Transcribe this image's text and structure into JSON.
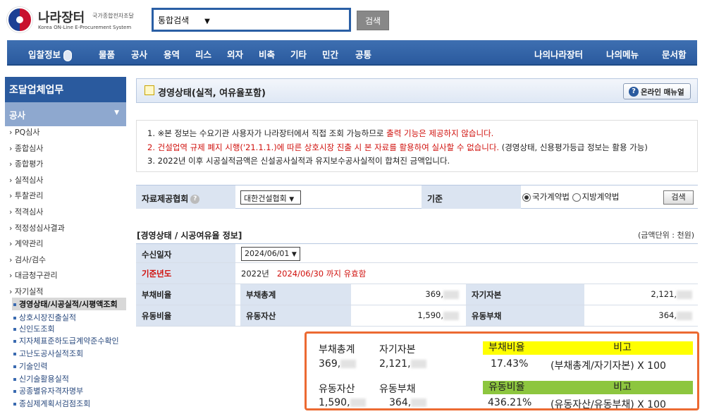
{
  "header": {
    "logo_title": "나라장터",
    "logo_subtitle": "국가종합전자조달",
    "logo_english": "Korea ON-Line E-Procurement System",
    "search_select": "통합검색",
    "search_button": "검색"
  },
  "gnb": {
    "items": [
      "입찰정보",
      "물품",
      "공사",
      "용역",
      "리스",
      "외자",
      "비축",
      "기타",
      "민간",
      "공통"
    ],
    "right_items": [
      "나의나라장터",
      "나의메뉴",
      "문서함"
    ]
  },
  "sidebar": {
    "title": "조달업체업무",
    "section": "공사",
    "items": [
      "PQ심사",
      "종합심사",
      "종합평가",
      "실적심사",
      "투찰관리",
      "적격심사",
      "적정성심사결과",
      "계약관리",
      "검사/검수",
      "대금청구관리",
      "자기실적"
    ],
    "sub_items": [
      "경영상태/시공실적/시평액조회",
      "상호시장진출실적",
      "신인도조회",
      "지자체표준하도급계약준수확인",
      "고난도공사실적조회",
      "기술인력",
      "신기술활용실적",
      "공종별유자격자명부",
      "종심제계획서검점조회"
    ]
  },
  "page": {
    "title": "경영상태(실적, 여유율포함)",
    "manual_button": "온라인 매뉴얼"
  },
  "notice": {
    "line1_a": "1. ※본 정보는 수요기관 사용자가 나라장터에서 직접 조회 가능하므로 ",
    "line1_red": "출력 기능은 제공하지 않습니다.",
    "line2_red": "2. 건설업역 규제 폐지 시행('21.1.1.)에 따른 상호시장 진출 시 본 자료를 활용하여 실사할 수 없습니다.",
    "line2_b": " (경영상태, 신용평가등급 정보는 활용 가능)",
    "line3": "3. 2022년 이후 시공실적금액은 신설공사실적과 유지보수공사실적이 합쳐진 금액입니다."
  },
  "criteria": {
    "assoc_label": "자료제공협회",
    "assoc_value": "대한건설협회",
    "basis_label": "기준",
    "radio1": "국가계약법",
    "radio2": "지방계약법",
    "search_button": "검색"
  },
  "info": {
    "section_title": "[경영상태 / 시공여유율 정보]",
    "unit": "(금액단위 : 천원)",
    "received_label": "수신일자",
    "received_value": "2024/06/01",
    "base_year_label": "기준년도",
    "base_year_value": "2022년",
    "valid_until": "2024/06/30 까지 유효함",
    "debt_ratio_label": "부채비율",
    "total_debt_label": "부채총계",
    "total_debt_value": "369,",
    "equity_label": "자기자본",
    "equity_value": "2,121,",
    "current_ratio_label": "유동비율",
    "current_assets_label": "유동자산",
    "current_assets_value": "1,590,",
    "current_liab_label": "유동부채",
    "current_liab_value": "364,"
  },
  "calc": {
    "h_total_debt": "부채총계",
    "h_equity": "자기자본",
    "h_debt_ratio": "부채비율",
    "h_note": "비고",
    "v_total_debt": "369,",
    "v_equity": "2,121,",
    "v_debt_ratio": "17.43%",
    "v_debt_formula": "(부채총계/자기자본) X 100",
    "h_current_assets": "유동자산",
    "h_current_liab": "유동부채",
    "h_current_ratio": "유동비율",
    "h_note2": "비고",
    "v_current_assets": "1,590,",
    "v_current_liab": "364,",
    "v_current_ratio": "436.21%",
    "v_current_formula": "(유동자산/유동부채) X 100",
    "color_yellow": "#ffff00",
    "color_green": "#8dc63f"
  }
}
